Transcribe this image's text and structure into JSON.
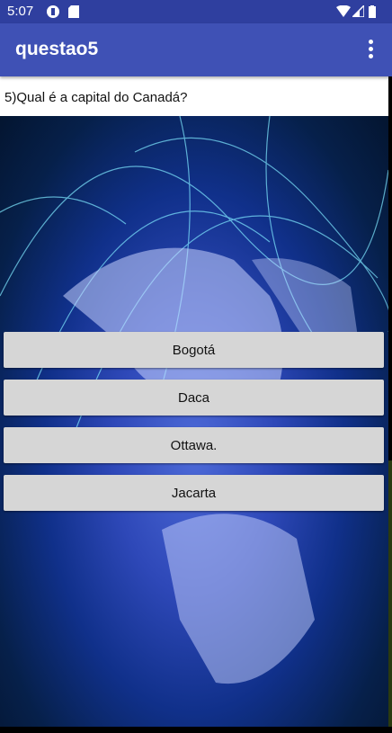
{
  "status_bar": {
    "time": "5:07",
    "icons": [
      "app-notification-icon",
      "sd-card-icon",
      "wifi-icon",
      "signal-icon",
      "battery-icon"
    ]
  },
  "app_bar": {
    "title": "questao5",
    "menu_icon": "overflow-menu-icon"
  },
  "question": "5)Qual é a capital do Canadá?",
  "answers": [
    "Bogotá",
    "Daca",
    "Ottawa.",
    "Jacarta"
  ],
  "colors": {
    "status_bar": "#2f3f9f",
    "app_bar": "#3f51b5",
    "button": "#d6d6d6"
  }
}
